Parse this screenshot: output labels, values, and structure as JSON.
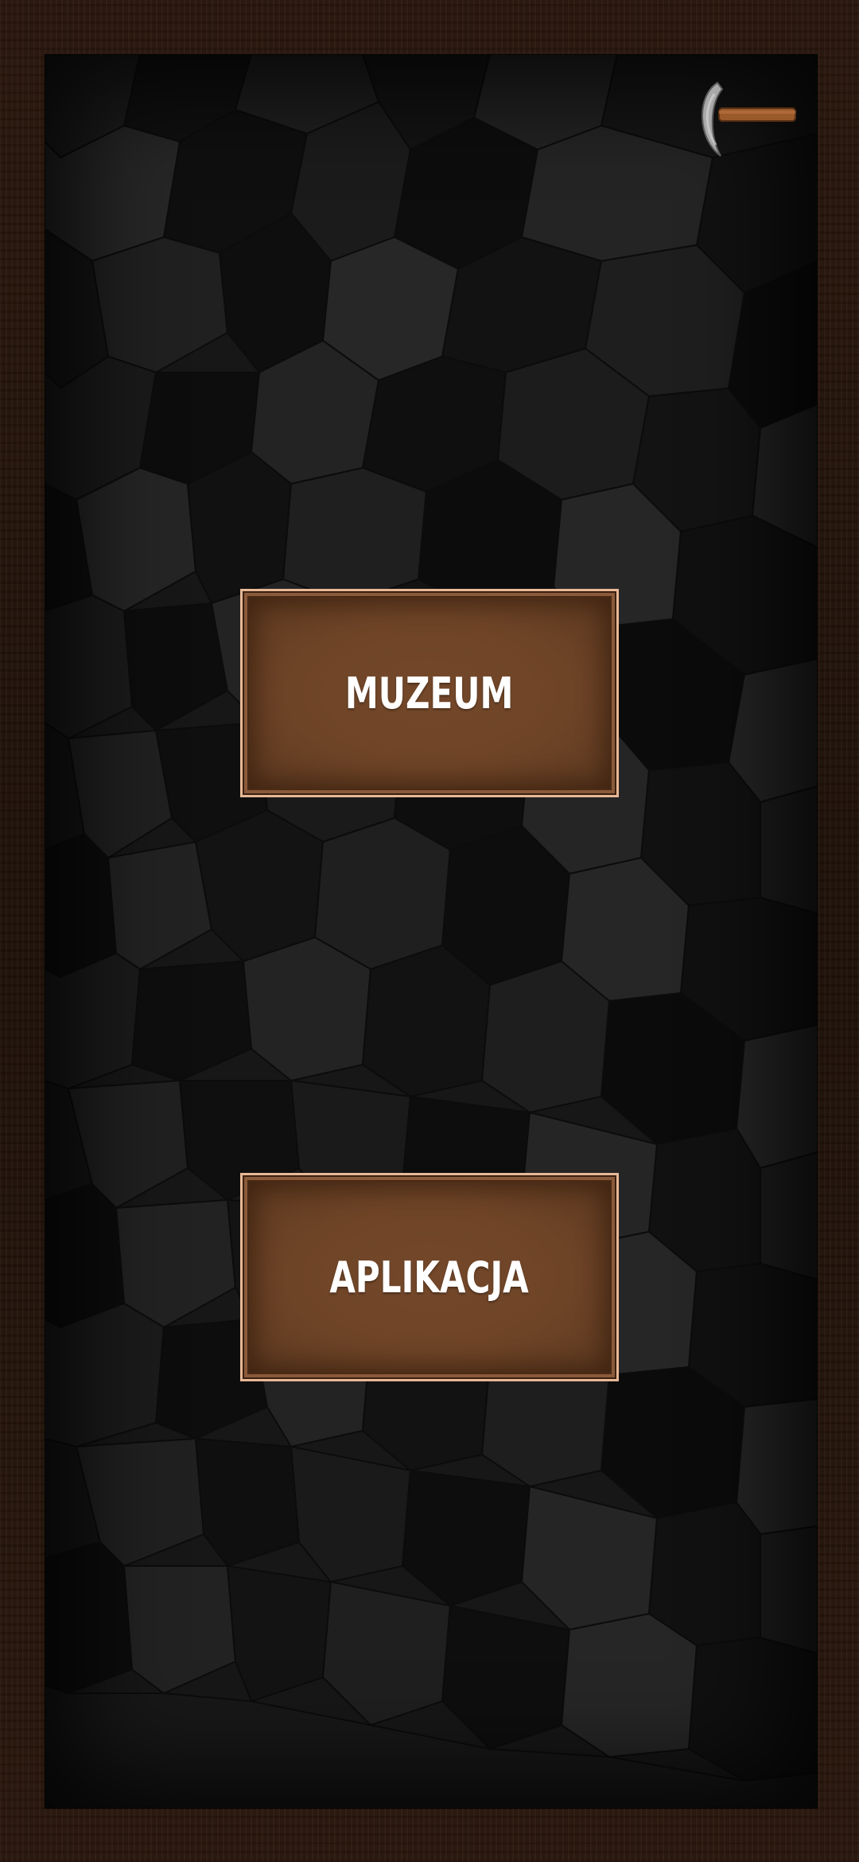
{
  "menu": {
    "muzeum_label": "MUZEUM",
    "aplikacja_label": "APLIKACJA"
  },
  "icons": {
    "top_right": "pickaxe-icon"
  },
  "colors": {
    "frame_wood": "#2a170d",
    "stone_background": "#161616",
    "button_fill": "#6e4427",
    "button_border": "#e8b896",
    "button_text": "#ffffff",
    "pickaxe_handle": "#9a5a2a",
    "pickaxe_blade": "#a8a8a8"
  }
}
